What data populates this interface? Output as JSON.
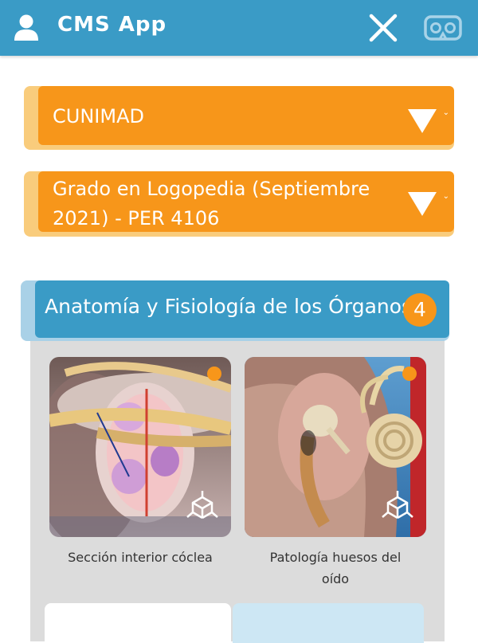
{
  "header": {
    "title": "CMS App",
    "icons": [
      "user-icon",
      "close-icon",
      "vr-headset-icon"
    ],
    "color": "#3a9bc6"
  },
  "dropdowns": {
    "institution": {
      "value": "CUNIMAD"
    },
    "degree": {
      "line1": "Grado en Logopedia (Septiembre",
      "line2": "2021) - PER 4106"
    },
    "color": "#f7961a"
  },
  "section": {
    "title": "Anatomía y Fisiología de los Órganos...",
    "count": "4"
  },
  "cards": [
    {
      "label": "Sección interior cóclea",
      "icon": "3d-model-icon"
    },
    {
      "label_line1": "Patología huesos del",
      "label_line2": "oído",
      "icon": "3d-model-icon"
    }
  ]
}
